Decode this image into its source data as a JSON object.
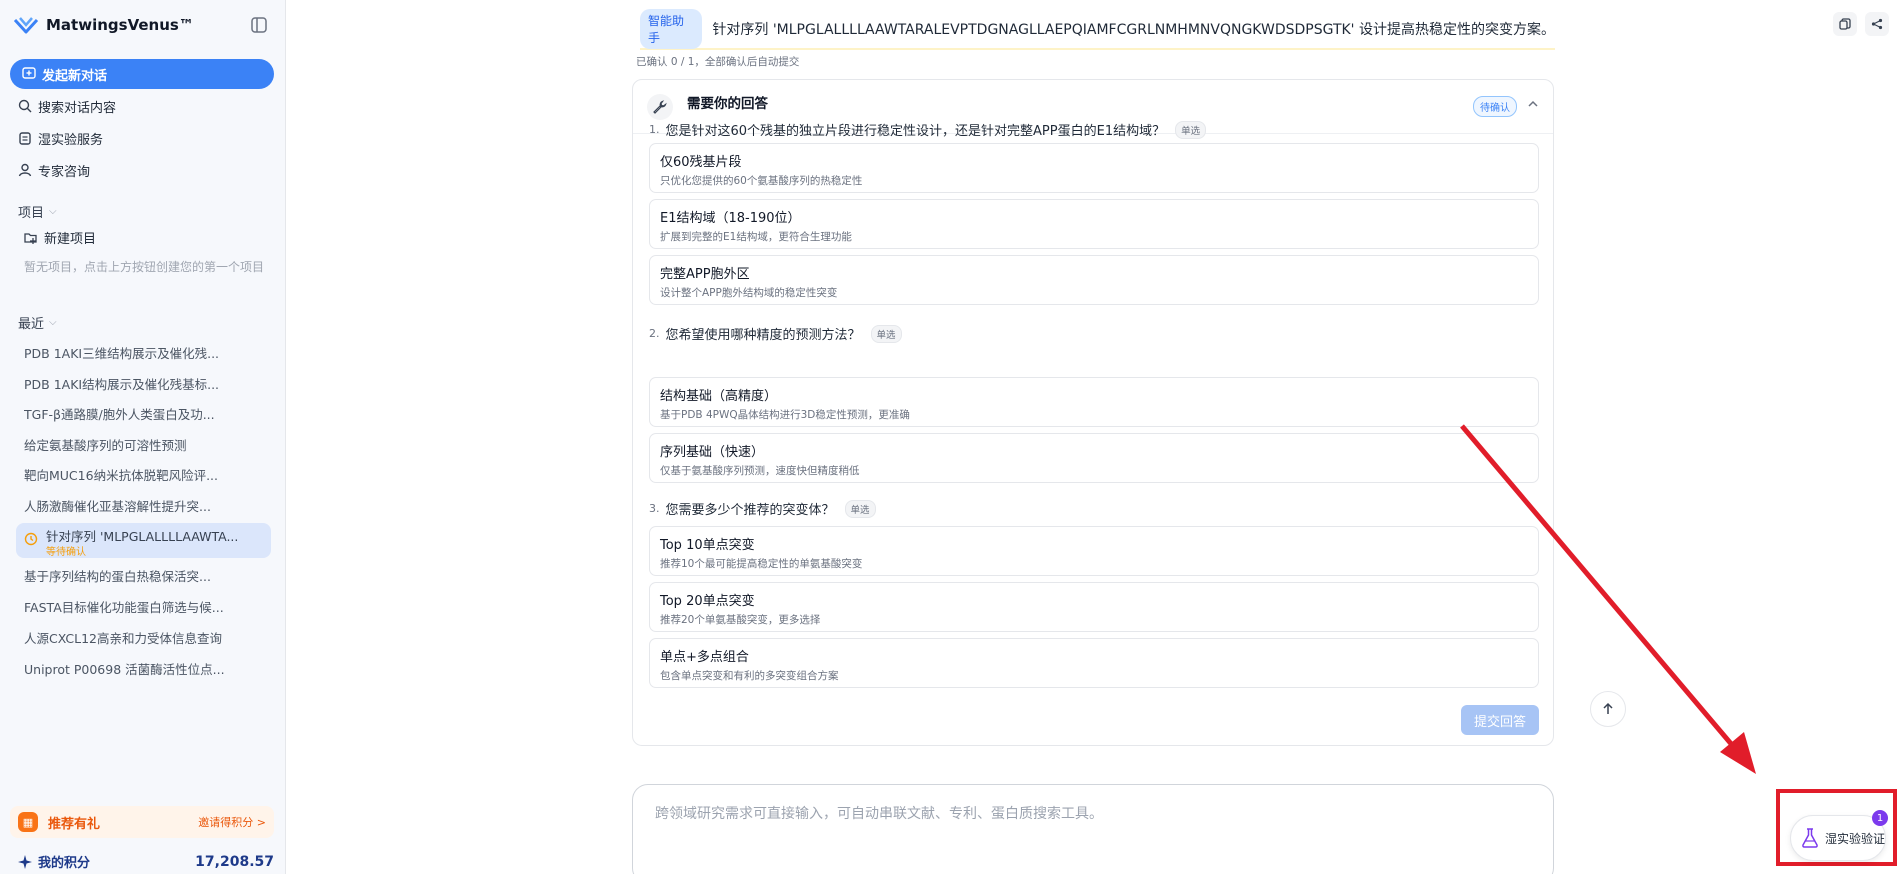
{
  "app": {
    "name": "MatwingsVenus™"
  },
  "sidebar": {
    "new_chat": "发起新对话",
    "nav": [
      {
        "label": "搜索对话内容",
        "icon": "search-icon"
      },
      {
        "label": "湿实验服务",
        "icon": "flask-service-icon"
      },
      {
        "label": "专家咨询",
        "icon": "user-icon"
      }
    ],
    "projects": {
      "title": "项目",
      "new_project": "新建项目",
      "empty_hint": "暂无项目，点击上方按钮创建您的第一个项目"
    },
    "recent": {
      "title": "最近",
      "items": [
        "PDB 1AKI三维结构展示及催化残...",
        "PDB 1AKI结构展示及催化残基标...",
        "TGF-β通路膜/胞外人类蛋白及功...",
        "给定氨基酸序列的可溶性预测",
        "靶向MUC16纳米抗体脱靶风险评...",
        "人肠激酶催化亚基溶解性提升突..."
      ],
      "active": {
        "title": "针对序列 'MLPGLALLLLAAWTA...",
        "status": "等待确认"
      },
      "items_after": [
        "基于序列结构的蛋白热稳保活突...",
        "FASTA目标催化功能蛋白筛选与候...",
        "人源CXCL12高亲和力受体信息查询",
        "Uniprot P00698 活菌酶活性位点..."
      ]
    },
    "reward": {
      "title": "推荐有礼",
      "link": "邀请得积分 >"
    },
    "points": {
      "label": "我的积分",
      "value": "17,208.57"
    }
  },
  "main": {
    "query_tag": "智能助手",
    "query_text": "针对序列 'MLPGLALLLLAAWTARALEVPTDGNAGLLAEPQIAMFCGRLNMHMNVQNGKWDSDPSGTK' 设计提高热稳定性的突变方案。",
    "confirm_count": "已确认 0 / 1，全部确认后自动提交",
    "card": {
      "title": "需要你的回答",
      "badge": "待确认",
      "questions": [
        {
          "num": "1.",
          "text": "您是针对这60个残基的独立片段进行稳定性设计，还是针对完整APP蛋白的E1结构域？",
          "tag": "单选",
          "options": [
            {
              "title": "仅60残基片段",
              "desc": "只优化您提供的60个氨基酸序列的热稳定性"
            },
            {
              "title": "E1结构域（18-190位）",
              "desc": "扩展到完整的E1结构域，更符合生理功能"
            },
            {
              "title": "完整APP胞外区",
              "desc": "设计整个APP胞外结构域的稳定性突变"
            }
          ]
        },
        {
          "num": "2.",
          "text": "您希望使用哪种精度的预测方法？",
          "tag": "单选",
          "options": [
            {
              "title": "结构基础（高精度）",
              "desc": "基于PDB 4PWQ晶体结构进行3D稳定性预测，更准确"
            },
            {
              "title": "序列基础（快速）",
              "desc": "仅基于氨基酸序列预测，速度快但精度稍低"
            }
          ]
        },
        {
          "num": "3.",
          "text": "您需要多少个推荐的突变体？",
          "tag": "单选",
          "options": [
            {
              "title": "Top 10单点突变",
              "desc": "推荐10个最可能提高稳定性的单氨基酸突变"
            },
            {
              "title": "Top 20单点突变",
              "desc": "推荐20个单氨基酸突变，更多选择"
            },
            {
              "title": "单点+多点组合",
              "desc": "包含单点突变和有利的多突变组合方案"
            }
          ]
        }
      ],
      "submit": "提交回答"
    },
    "composer_placeholder": "跨领域研究需求可直接输入，可自动串联文献、专利、蛋白质搜索工具。",
    "wet_lab": {
      "label": "湿实验验证",
      "badge": "1"
    }
  },
  "colors": {
    "accent": "#3b82f6",
    "annotation": "#e11d2a",
    "reward": "#ea580c"
  }
}
